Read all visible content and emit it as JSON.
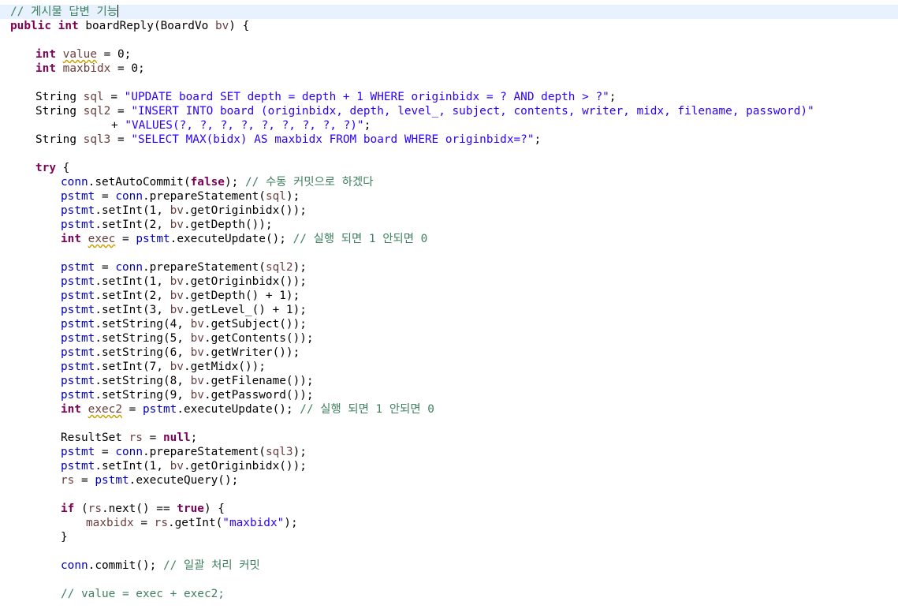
{
  "editor": {
    "lines": [
      {
        "row": 0,
        "indent": 0,
        "tokens": [
          {
            "t": "// 게시물 답변 기능",
            "c": "cmt"
          }
        ],
        "caret": true,
        "current": true
      },
      {
        "row": 1,
        "indent": 0,
        "tokens": [
          {
            "t": "public",
            "c": "kw"
          },
          {
            "t": " ",
            "c": "pl"
          },
          {
            "t": "int",
            "c": "kw"
          },
          {
            "t": " boardReply(BoardVo ",
            "c": "pl"
          },
          {
            "t": "bv",
            "c": "lv"
          },
          {
            "t": ") {",
            "c": "pl"
          }
        ]
      },
      {
        "row": 3,
        "indent": 4,
        "tokens": [
          {
            "t": "int",
            "c": "kw"
          },
          {
            "t": " ",
            "c": "pl"
          },
          {
            "t": "value",
            "c": "lv",
            "w": true
          },
          {
            "t": " = 0;",
            "c": "pl"
          }
        ]
      },
      {
        "row": 4,
        "indent": 4,
        "tokens": [
          {
            "t": "int",
            "c": "kw"
          },
          {
            "t": " ",
            "c": "pl"
          },
          {
            "t": "maxbidx",
            "c": "lv"
          },
          {
            "t": " = 0;",
            "c": "pl"
          }
        ]
      },
      {
        "row": 6,
        "indent": 4,
        "tokens": [
          {
            "t": "String ",
            "c": "pl"
          },
          {
            "t": "sql",
            "c": "lv"
          },
          {
            "t": " = ",
            "c": "pl"
          },
          {
            "t": "\"UPDATE board SET depth = depth + 1 WHERE originbidx = ? AND depth > ?\"",
            "c": "str"
          },
          {
            "t": ";",
            "c": "pl"
          }
        ]
      },
      {
        "row": 7,
        "indent": 4,
        "tokens": [
          {
            "t": "String ",
            "c": "pl"
          },
          {
            "t": "sql2",
            "c": "lv"
          },
          {
            "t": " = ",
            "c": "pl"
          },
          {
            "t": "\"INSERT INTO board (originbidx, depth, level_, subject, contents, writer, midx, filename, password)\"",
            "c": "str"
          }
        ]
      },
      {
        "row": 8,
        "indent": 16,
        "tokens": [
          {
            "t": "+ ",
            "c": "pl"
          },
          {
            "t": "\"VALUES(?, ?, ?, ?, ?, ?, ?, ?, ?)\"",
            "c": "str"
          },
          {
            "t": ";",
            "c": "pl"
          }
        ]
      },
      {
        "row": 9,
        "indent": 4,
        "tokens": [
          {
            "t": "String ",
            "c": "pl"
          },
          {
            "t": "sql3",
            "c": "lv"
          },
          {
            "t": " = ",
            "c": "pl"
          },
          {
            "t": "\"SELECT MAX(bidx) AS maxbidx FROM board WHERE originbidx=?\"",
            "c": "str"
          },
          {
            "t": ";",
            "c": "pl"
          }
        ]
      },
      {
        "row": 11,
        "indent": 4,
        "tokens": [
          {
            "t": "try",
            "c": "kw"
          },
          {
            "t": " {",
            "c": "pl"
          }
        ]
      },
      {
        "row": 12,
        "indent": 8,
        "tokens": [
          {
            "t": "conn",
            "c": "fld"
          },
          {
            "t": ".setAutoCommit(",
            "c": "pl"
          },
          {
            "t": "false",
            "c": "kw"
          },
          {
            "t": "); ",
            "c": "pl"
          },
          {
            "t": "// 수동 커밋으로 하겠다",
            "c": "cmt"
          }
        ]
      },
      {
        "row": 13,
        "indent": 8,
        "tokens": [
          {
            "t": "pstmt",
            "c": "fld"
          },
          {
            "t": " = ",
            "c": "pl"
          },
          {
            "t": "conn",
            "c": "fld"
          },
          {
            "t": ".prepareStatement(",
            "c": "pl"
          },
          {
            "t": "sql",
            "c": "lv"
          },
          {
            "t": ");",
            "c": "pl"
          }
        ]
      },
      {
        "row": 14,
        "indent": 8,
        "tokens": [
          {
            "t": "pstmt",
            "c": "fld"
          },
          {
            "t": ".setInt(1, ",
            "c": "pl"
          },
          {
            "t": "bv",
            "c": "lv"
          },
          {
            "t": ".getOriginbidx());",
            "c": "pl"
          }
        ]
      },
      {
        "row": 15,
        "indent": 8,
        "tokens": [
          {
            "t": "pstmt",
            "c": "fld"
          },
          {
            "t": ".setInt(2, ",
            "c": "pl"
          },
          {
            "t": "bv",
            "c": "lv"
          },
          {
            "t": ".getDepth());",
            "c": "pl"
          }
        ]
      },
      {
        "row": 16,
        "indent": 8,
        "tokens": [
          {
            "t": "int",
            "c": "kw"
          },
          {
            "t": " ",
            "c": "pl"
          },
          {
            "t": "exec",
            "c": "lv",
            "w": true
          },
          {
            "t": " = ",
            "c": "pl"
          },
          {
            "t": "pstmt",
            "c": "fld"
          },
          {
            "t": ".executeUpdate(); ",
            "c": "pl"
          },
          {
            "t": "// 실행 되면 1 안되면 0",
            "c": "cmt"
          }
        ]
      },
      {
        "row": 18,
        "indent": 8,
        "tokens": [
          {
            "t": "pstmt",
            "c": "fld"
          },
          {
            "t": " = ",
            "c": "pl"
          },
          {
            "t": "conn",
            "c": "fld"
          },
          {
            "t": ".prepareStatement(",
            "c": "pl"
          },
          {
            "t": "sql2",
            "c": "lv"
          },
          {
            "t": ");",
            "c": "pl"
          }
        ]
      },
      {
        "row": 19,
        "indent": 8,
        "tokens": [
          {
            "t": "pstmt",
            "c": "fld"
          },
          {
            "t": ".setInt(1, ",
            "c": "pl"
          },
          {
            "t": "bv",
            "c": "lv"
          },
          {
            "t": ".getOriginbidx());",
            "c": "pl"
          }
        ]
      },
      {
        "row": 20,
        "indent": 8,
        "tokens": [
          {
            "t": "pstmt",
            "c": "fld"
          },
          {
            "t": ".setInt(2, ",
            "c": "pl"
          },
          {
            "t": "bv",
            "c": "lv"
          },
          {
            "t": ".getDepth() + 1);",
            "c": "pl"
          }
        ]
      },
      {
        "row": 21,
        "indent": 8,
        "tokens": [
          {
            "t": "pstmt",
            "c": "fld"
          },
          {
            "t": ".setInt(3, ",
            "c": "pl"
          },
          {
            "t": "bv",
            "c": "lv"
          },
          {
            "t": ".getLevel_() + 1);",
            "c": "pl"
          }
        ]
      },
      {
        "row": 22,
        "indent": 8,
        "tokens": [
          {
            "t": "pstmt",
            "c": "fld"
          },
          {
            "t": ".setString(4, ",
            "c": "pl"
          },
          {
            "t": "bv",
            "c": "lv"
          },
          {
            "t": ".getSubject());",
            "c": "pl"
          }
        ]
      },
      {
        "row": 23,
        "indent": 8,
        "tokens": [
          {
            "t": "pstmt",
            "c": "fld"
          },
          {
            "t": ".setString(5, ",
            "c": "pl"
          },
          {
            "t": "bv",
            "c": "lv"
          },
          {
            "t": ".getContents());",
            "c": "pl"
          }
        ]
      },
      {
        "row": 24,
        "indent": 8,
        "tokens": [
          {
            "t": "pstmt",
            "c": "fld"
          },
          {
            "t": ".setString(6, ",
            "c": "pl"
          },
          {
            "t": "bv",
            "c": "lv"
          },
          {
            "t": ".getWriter());",
            "c": "pl"
          }
        ]
      },
      {
        "row": 25,
        "indent": 8,
        "tokens": [
          {
            "t": "pstmt",
            "c": "fld"
          },
          {
            "t": ".setInt(7, ",
            "c": "pl"
          },
          {
            "t": "bv",
            "c": "lv"
          },
          {
            "t": ".getMidx());",
            "c": "pl"
          }
        ]
      },
      {
        "row": 26,
        "indent": 8,
        "tokens": [
          {
            "t": "pstmt",
            "c": "fld"
          },
          {
            "t": ".setString(8, ",
            "c": "pl"
          },
          {
            "t": "bv",
            "c": "lv"
          },
          {
            "t": ".getFilename());",
            "c": "pl"
          }
        ]
      },
      {
        "row": 27,
        "indent": 8,
        "tokens": [
          {
            "t": "pstmt",
            "c": "fld"
          },
          {
            "t": ".setString(9, ",
            "c": "pl"
          },
          {
            "t": "bv",
            "c": "lv"
          },
          {
            "t": ".getPassword());",
            "c": "pl"
          }
        ]
      },
      {
        "row": 28,
        "indent": 8,
        "tokens": [
          {
            "t": "int",
            "c": "kw"
          },
          {
            "t": " ",
            "c": "pl"
          },
          {
            "t": "exec2",
            "c": "lv",
            "w": true
          },
          {
            "t": " = ",
            "c": "pl"
          },
          {
            "t": "pstmt",
            "c": "fld"
          },
          {
            "t": ".executeUpdate(); ",
            "c": "pl"
          },
          {
            "t": "// 실행 되면 1 안되면 0",
            "c": "cmt"
          }
        ]
      },
      {
        "row": 30,
        "indent": 8,
        "tokens": [
          {
            "t": "ResultSet ",
            "c": "pl"
          },
          {
            "t": "rs",
            "c": "lv"
          },
          {
            "t": " = ",
            "c": "pl"
          },
          {
            "t": "null",
            "c": "kw"
          },
          {
            "t": ";",
            "c": "pl"
          }
        ]
      },
      {
        "row": 31,
        "indent": 8,
        "tokens": [
          {
            "t": "pstmt",
            "c": "fld"
          },
          {
            "t": " = ",
            "c": "pl"
          },
          {
            "t": "conn",
            "c": "fld"
          },
          {
            "t": ".prepareStatement(",
            "c": "pl"
          },
          {
            "t": "sql3",
            "c": "lv"
          },
          {
            "t": ");",
            "c": "pl"
          }
        ]
      },
      {
        "row": 32,
        "indent": 8,
        "tokens": [
          {
            "t": "pstmt",
            "c": "fld"
          },
          {
            "t": ".setInt(1, ",
            "c": "pl"
          },
          {
            "t": "bv",
            "c": "lv"
          },
          {
            "t": ".getOriginbidx());",
            "c": "pl"
          }
        ]
      },
      {
        "row": 33,
        "indent": 8,
        "tokens": [
          {
            "t": "rs",
            "c": "lv"
          },
          {
            "t": " = ",
            "c": "pl"
          },
          {
            "t": "pstmt",
            "c": "fld"
          },
          {
            "t": ".executeQuery();",
            "c": "pl"
          }
        ]
      },
      {
        "row": 35,
        "indent": 8,
        "tokens": [
          {
            "t": "if",
            "c": "kw"
          },
          {
            "t": " (",
            "c": "pl"
          },
          {
            "t": "rs",
            "c": "lv"
          },
          {
            "t": ".next() == ",
            "c": "pl"
          },
          {
            "t": "true",
            "c": "kw"
          },
          {
            "t": ") {",
            "c": "pl"
          }
        ]
      },
      {
        "row": 36,
        "indent": 12,
        "tokens": [
          {
            "t": "maxbidx",
            "c": "lv"
          },
          {
            "t": " = ",
            "c": "pl"
          },
          {
            "t": "rs",
            "c": "lv"
          },
          {
            "t": ".getInt(",
            "c": "pl"
          },
          {
            "t": "\"maxbidx\"",
            "c": "str"
          },
          {
            "t": ");",
            "c": "pl"
          }
        ]
      },
      {
        "row": 37,
        "indent": 8,
        "tokens": [
          {
            "t": "}",
            "c": "pl"
          }
        ]
      },
      {
        "row": 39,
        "indent": 8,
        "tokens": [
          {
            "t": "conn",
            "c": "fld"
          },
          {
            "t": ".commit(); ",
            "c": "pl"
          },
          {
            "t": "// 일괄 처리 커밋",
            "c": "cmt"
          }
        ]
      },
      {
        "row": 41,
        "indent": 8,
        "tokens": [
          {
            "t": "// value = exec + exec2;",
            "c": "cmt"
          }
        ]
      }
    ]
  }
}
